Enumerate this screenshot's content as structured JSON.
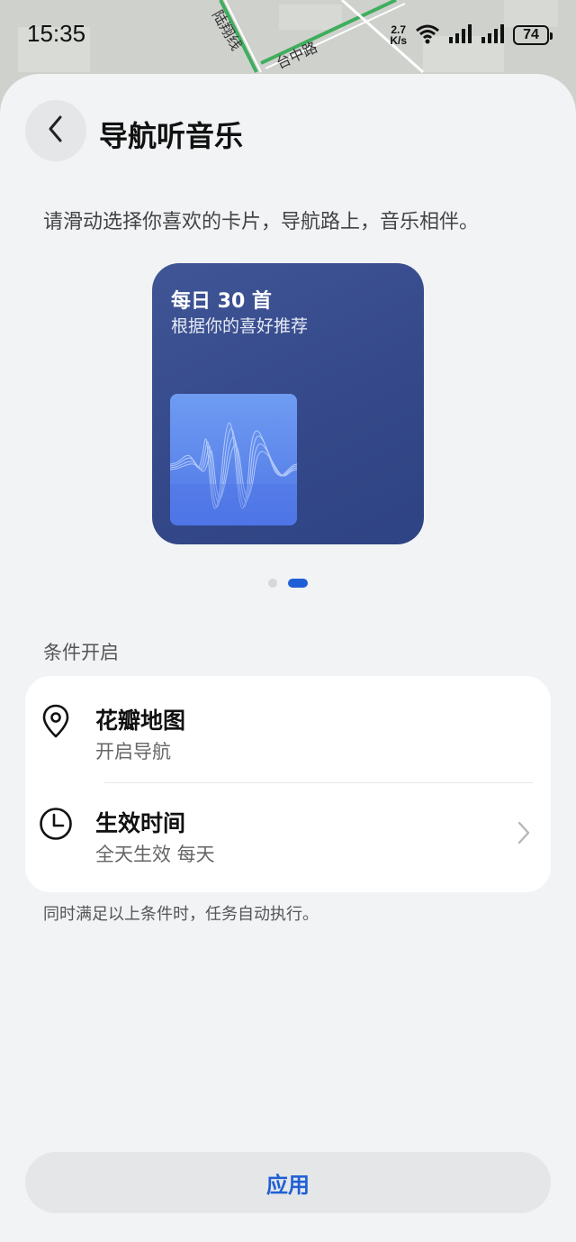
{
  "status_bar": {
    "time": "15:35",
    "net_speed_value": "2.7",
    "net_speed_unit": "K/s",
    "battery_level": "74"
  },
  "map": {
    "road_label_1": "陆翔线",
    "road_label_2": "台中路"
  },
  "header": {
    "title": "导航听音乐"
  },
  "intro": "请滑动选择你喜欢的卡片，导航路上，音乐相伴。",
  "card": {
    "title": "每日 30 首",
    "subtitle": "根据你的喜好推荐"
  },
  "pager": {
    "count": 2,
    "active_index": 1
  },
  "conditions": {
    "section_label": "条件开启",
    "items": [
      {
        "icon": "location-pin-icon",
        "title": "花瓣地图",
        "subtitle": "开启导航"
      },
      {
        "icon": "clock-icon",
        "title": "生效时间",
        "subtitle": "全天生效 每天"
      }
    ],
    "footnote": "同时满足以上条件时，任务自动执行。"
  },
  "actions": {
    "apply_label": "应用"
  },
  "colors": {
    "accent": "#1f5fd6",
    "card_bg": "#3a4f8f",
    "sheet_bg": "#f1f3f5"
  }
}
